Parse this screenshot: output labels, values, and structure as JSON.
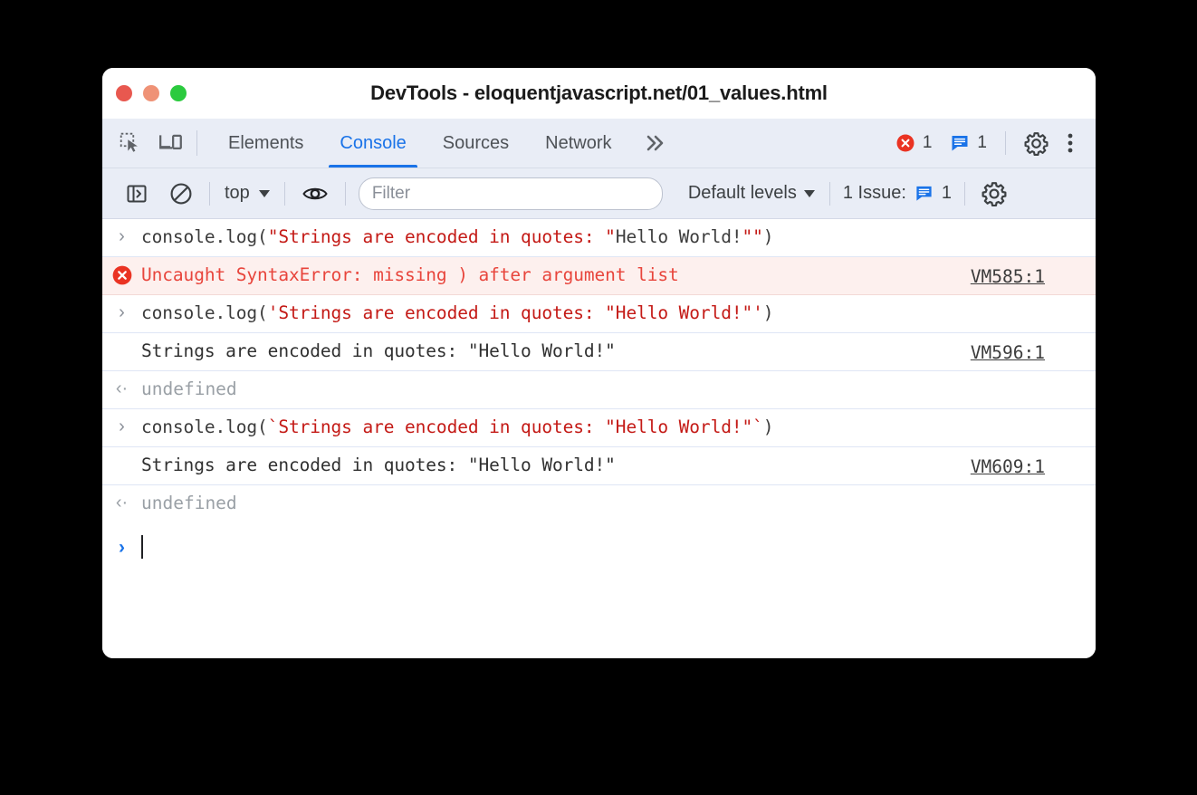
{
  "window": {
    "title": "DevTools - eloquentjavascript.net/01_values.html",
    "traffic_lights": [
      "close",
      "minimize",
      "zoom"
    ]
  },
  "tabbar": {
    "inspect_icon": "inspect-element-icon",
    "device_icon": "device-toolbar-icon",
    "tabs": [
      {
        "label": "Elements",
        "active": false
      },
      {
        "label": "Console",
        "active": true
      },
      {
        "label": "Sources",
        "active": false
      },
      {
        "label": "Network",
        "active": false
      }
    ],
    "more_label": "»",
    "error_count": "1",
    "message_count": "1",
    "settings_icon": "gear-icon",
    "menu_icon": "kebab-menu-icon"
  },
  "toolbar": {
    "sidebar_toggle_icon": "show-console-sidebar-icon",
    "clear_icon": "clear-console-icon",
    "context": "top",
    "eye_icon": "live-expression-eye-icon",
    "filter_placeholder": "Filter",
    "filter_value": "",
    "levels_label": "Default levels",
    "issues_label": "1 Issue:",
    "issues_count": "1",
    "settings_icon": "console-settings-gear-icon"
  },
  "console": {
    "rows": [
      {
        "kind": "input",
        "marker": "›",
        "segments": [
          {
            "text": "console.log(",
            "style": "plain"
          },
          {
            "text": "\"Strings are encoded in quotes: \"",
            "style": "string"
          },
          {
            "text": "Hello World!",
            "style": "plain"
          },
          {
            "text": "\"\"",
            "style": "string"
          },
          {
            "text": ")",
            "style": "plain"
          }
        ],
        "full_text": "console.log(\"Strings are encoded in quotes: \"Hello World!\"\")",
        "source": ""
      },
      {
        "kind": "error",
        "marker": "error-circle-icon",
        "text": "Uncaught SyntaxError: missing ) after argument list",
        "source": "VM585:1"
      },
      {
        "kind": "input",
        "marker": "›",
        "segments": [
          {
            "text": "console.log(",
            "style": "plain"
          },
          {
            "text": "'Strings are encoded in quotes: \"Hello World!\"'",
            "style": "string"
          },
          {
            "text": ")",
            "style": "plain"
          }
        ],
        "full_text": "console.log('Strings are encoded in quotes: \"Hello World!\"')",
        "source": ""
      },
      {
        "kind": "output",
        "marker": "",
        "text": "Strings are encoded in quotes: \"Hello World!\"",
        "source": "VM596:1"
      },
      {
        "kind": "result",
        "marker": "‹·",
        "text": "undefined",
        "source": ""
      },
      {
        "kind": "input",
        "marker": "›",
        "segments": [
          {
            "text": "console.log(",
            "style": "plain"
          },
          {
            "text": "`Strings are encoded in quotes: \"Hello World!\"`",
            "style": "string"
          },
          {
            "text": ")",
            "style": "plain"
          }
        ],
        "full_text": "console.log(`Strings are encoded in quotes: \"Hello World!\"`)",
        "source": ""
      },
      {
        "kind": "output",
        "marker": "",
        "text": "Strings are encoded in quotes: \"Hello World!\"",
        "source": "VM609:1"
      },
      {
        "kind": "result",
        "marker": "‹·",
        "text": "undefined",
        "source": ""
      }
    ],
    "prompt_marker": "›",
    "prompt_value": ""
  },
  "colors": {
    "accent_blue": "#1a73e8",
    "error_red": "#e8453c",
    "string_red": "#c41a16",
    "error_row_bg": "#fdf0ee",
    "toolbar_bg": "#e9edf6",
    "muted_gray": "#9aa0a6"
  }
}
